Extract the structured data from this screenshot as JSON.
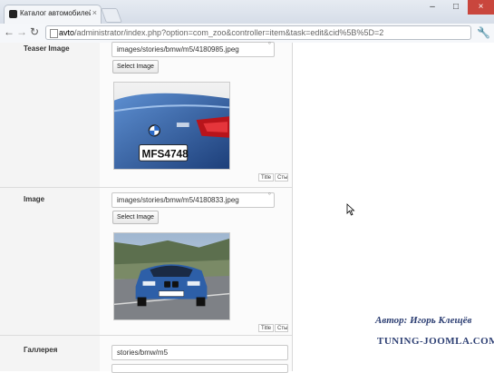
{
  "browser": {
    "tab_title": "Каталог автомобилей - A",
    "url_host": "avto",
    "url_path": "/administrator/index.php?option=com_zoo&controller=item&task=edit&cid%5B%5D=2"
  },
  "form": {
    "teaser_image": {
      "label": "Teaser Image",
      "value": "images/stories/bmw/m5/4180985.jpeg",
      "select_label": "Select Image",
      "title_label": "Title",
      "second_label": "Сты"
    },
    "image": {
      "label": "Image",
      "value": "images/stories/bmw/m5/4180833.jpeg",
      "select_label": "Select Image",
      "title_label": "Title",
      "second_label": "Сты"
    },
    "gallery": {
      "label": "Галлерея",
      "value": "stories/bmw/m5"
    }
  },
  "watermark": {
    "author": "Автор: Игорь Клещёв",
    "site": "TUNING-JOOMLA.COM"
  },
  "colors": {
    "car_blue": "#2d5fa8",
    "watermark": "#2d3f73"
  }
}
